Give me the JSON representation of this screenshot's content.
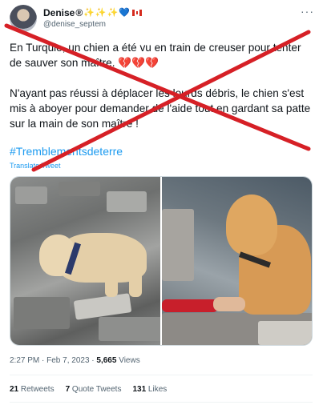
{
  "author": {
    "name": "Denise",
    "name_badges": "®",
    "handle": "@denise_septem",
    "emojis": [
      "✨",
      "✨",
      "✨",
      "💙"
    ],
    "flag": "Canada"
  },
  "tweet": {
    "paragraph1": "En Turquie, un chien a été vu en train de creuser pour tenter de sauver son maître.",
    "paragraph1_emojis": "💔💔💔",
    "paragraph2": "N'ayant pas réussi à déplacer les lourds débris, le chien s'est mis à aboyer pour demander de l'aide tout en gardant sa patte sur la main de son maître !",
    "hashtag": "#Tremblementsdeterre",
    "translate": "Translate Tweet"
  },
  "meta": {
    "time": "2:27 PM",
    "sep": " · ",
    "date": "Feb 7, 2023",
    "views_count": "5,665",
    "views_label": " Views"
  },
  "stats": {
    "retweets_count": "21",
    "retweets_label": " Retweets",
    "quotes_count": "7",
    "quotes_label": " Quote Tweets",
    "likes_count": "131",
    "likes_label": " Likes"
  },
  "colors": {
    "link": "#1d9bf0",
    "cross": "#d62026",
    "muted": "#536471"
  },
  "icons": [
    "more-icon"
  ]
}
